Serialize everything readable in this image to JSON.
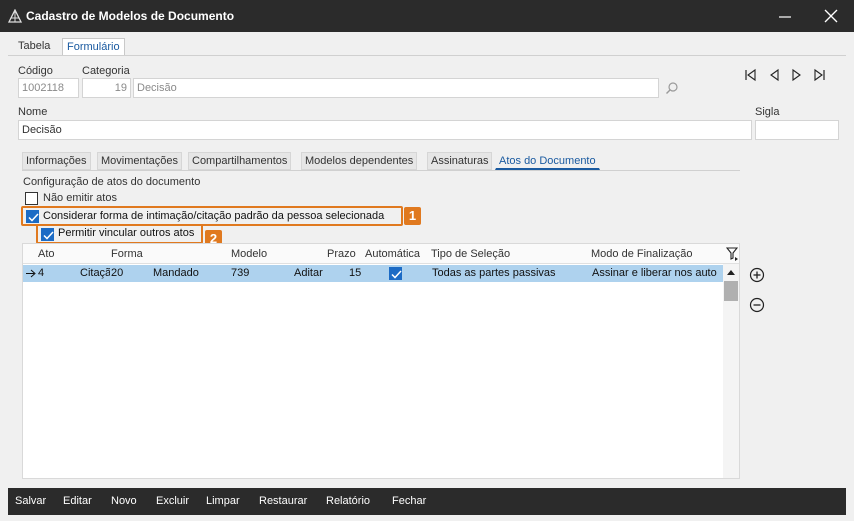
{
  "window": {
    "title": "Cadastro de Modelos de Documento",
    "app_icon": "app-logo-icon",
    "minimize_icon": "minimize-icon",
    "close_icon": "close-icon"
  },
  "top_tabs": [
    "Tabela",
    "Formulário"
  ],
  "form": {
    "codigo_label": "Código",
    "codigo_value": "1002118",
    "categoria_label": "Categoria",
    "categoria_num": "19",
    "categoria_name": "Decisão",
    "nome_label": "Nome",
    "nome_value": "Decisão",
    "sigla_label": "Sigla",
    "sigla_value": ""
  },
  "record_nav": [
    "first-record-icon",
    "previous-record-icon",
    "next-record-icon",
    "last-record-icon"
  ],
  "sub_tabs": [
    "Informações",
    "Movimentações",
    "Compartilhamentos",
    "Modelos dependentes",
    "Assinaturas",
    "Atos do Documento"
  ],
  "atos": {
    "section_label": "Configuração de atos do documento",
    "nao_emitir_label": "Não emitir atos",
    "nao_emitir_checked": false,
    "considerar_label": "Considerar forma de intimação/citação padrão da pessoa selecionada",
    "considerar_checked": true,
    "permitir_label": "Permitir vincular outros atos",
    "permitir_checked": true,
    "badge1": "1",
    "badge2": "2",
    "highlight_color": "#e0791f"
  },
  "grid": {
    "columns": [
      "Ato",
      "Forma",
      "Modelo",
      "Prazo",
      "Automática",
      "Tipo de Seleção",
      "Modo de Finalização"
    ],
    "rows": [
      {
        "ato": "4",
        "forma_abbr": "Citaçã",
        "forma_num": "20",
        "forma_name": "Mandado",
        "modelo_num": "739",
        "modelo_name": "Aditar",
        "prazo": "15",
        "automatica": true,
        "tipo_selecao": "Todas as partes passivas",
        "modo_finalizacao": "Assinar e liberar nos autos"
      }
    ],
    "selected_row_color": "#aed2ee"
  },
  "side_actions": [
    "add-icon",
    "remove-icon"
  ],
  "toolbar": [
    "Salvar",
    "Editar",
    "Novo",
    "Excluir",
    "Limpar",
    "Restaurar",
    "Relatório",
    "Fechar"
  ]
}
